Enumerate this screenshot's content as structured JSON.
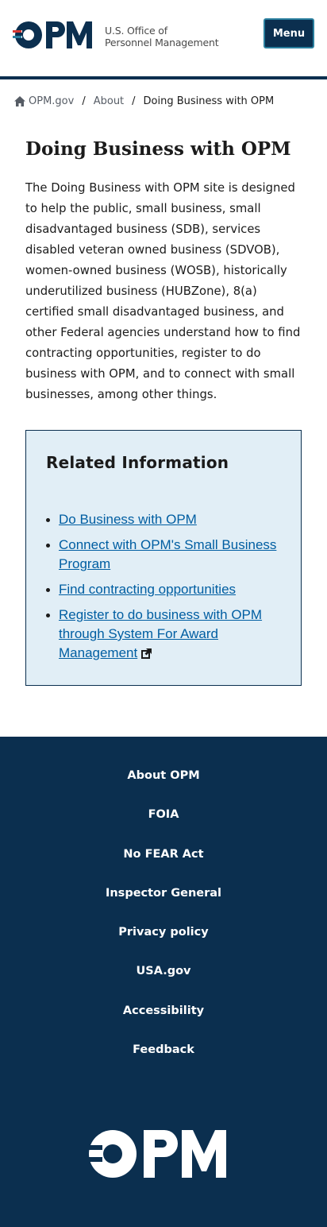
{
  "header": {
    "logo_text": "OPM",
    "agency_line1": "U.S. Office of",
    "agency_line2": "Personnel Management",
    "menu_label": "Menu"
  },
  "breadcrumb": {
    "home": "OPM.gov",
    "separator": "/",
    "about": "About",
    "current": "Doing Business with OPM"
  },
  "main": {
    "title": "Doing Business with OPM",
    "intro": "The Doing Business with OPM site is designed to help the public, small business, small disadvantaged business (SDB), services disabled veteran owned business (SDVOB), women-owned business (WOSB), historically underutilized business (HUBZone), 8(a) certified small disadvantaged business, and other Federal agencies understand how to find contracting opportunities, register to do business with OPM, and to connect with small businesses, among other things."
  },
  "related": {
    "title": "Related Information",
    "links": [
      "Do Business with OPM",
      "Connect with OPM's Small Business Program",
      "Find contracting opportunities",
      "Register to do business with OPM through System For Award Management"
    ]
  },
  "footer": {
    "links": [
      "About OPM",
      "FOIA",
      "No FEAR Act",
      "Inspector General",
      "Privacy policy",
      "USA.gov",
      "Accessibility",
      "Feedback"
    ],
    "logo_text": "OPM"
  },
  "colors": {
    "navy": "#0b2f4f",
    "link": "#005ea2",
    "box_bg": "#e1eef6",
    "logo_red": "#d83933",
    "logo_teal": "#2a7f9e"
  }
}
